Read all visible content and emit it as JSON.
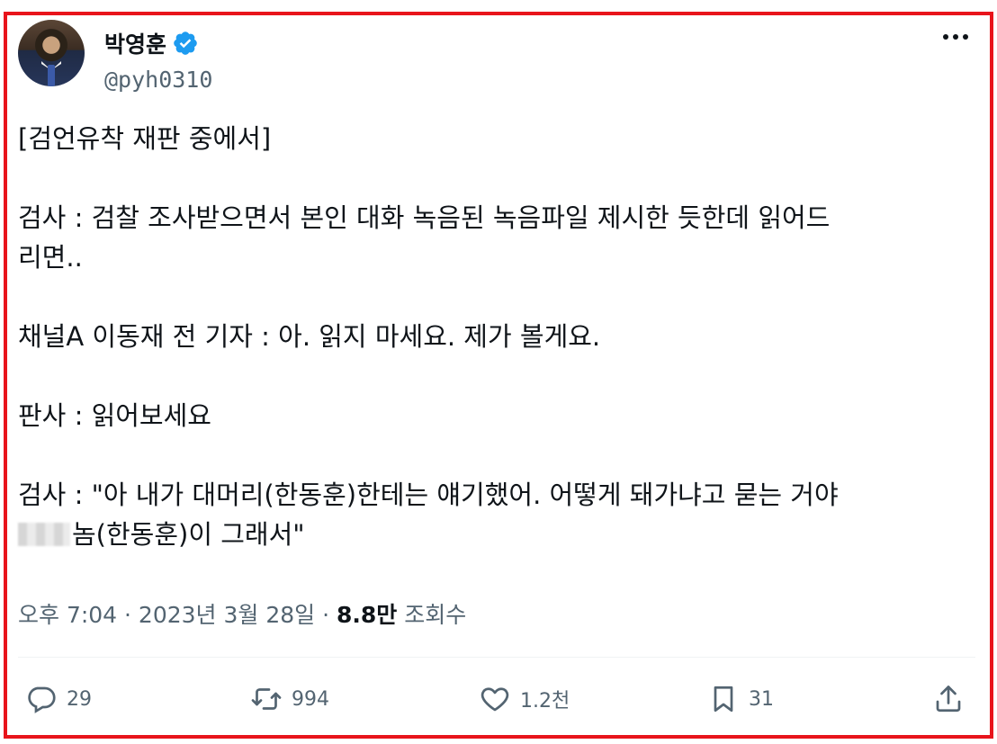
{
  "author": {
    "name": "박영훈",
    "handle": "@pyh0310",
    "verified": true
  },
  "tweet": {
    "line1": "[검언유착 재판 중에서]",
    "line2": "검사 : 검찰 조사받으면서 본인 대화 녹음된 녹음파일 제시한 듯한데 읽어드",
    "line3": "리면..",
    "line4": "채널A 이동재 전 기자 : 아. 읽지 마세요. 제가 볼게요.",
    "line5": "판사 : 읽어보세요",
    "line6": "검사 : \"아 내가 대머리(한동훈)한테는 얘기했어. 어떻게 돼가냐고 묻는 거야",
    "line7": "놈(한동훈)이 그래서\""
  },
  "meta": {
    "time": "오후 7:04 · 2023년 3월 28일 · ",
    "views_count": "8.8만",
    "views_label": " 조회수"
  },
  "actions": {
    "replies": "29",
    "retweets": "994",
    "likes": "1.2천",
    "bookmarks": "31"
  },
  "colors": {
    "border": "#e8141b",
    "verified": "#1d9bf0",
    "secondary_text": "#536471"
  }
}
